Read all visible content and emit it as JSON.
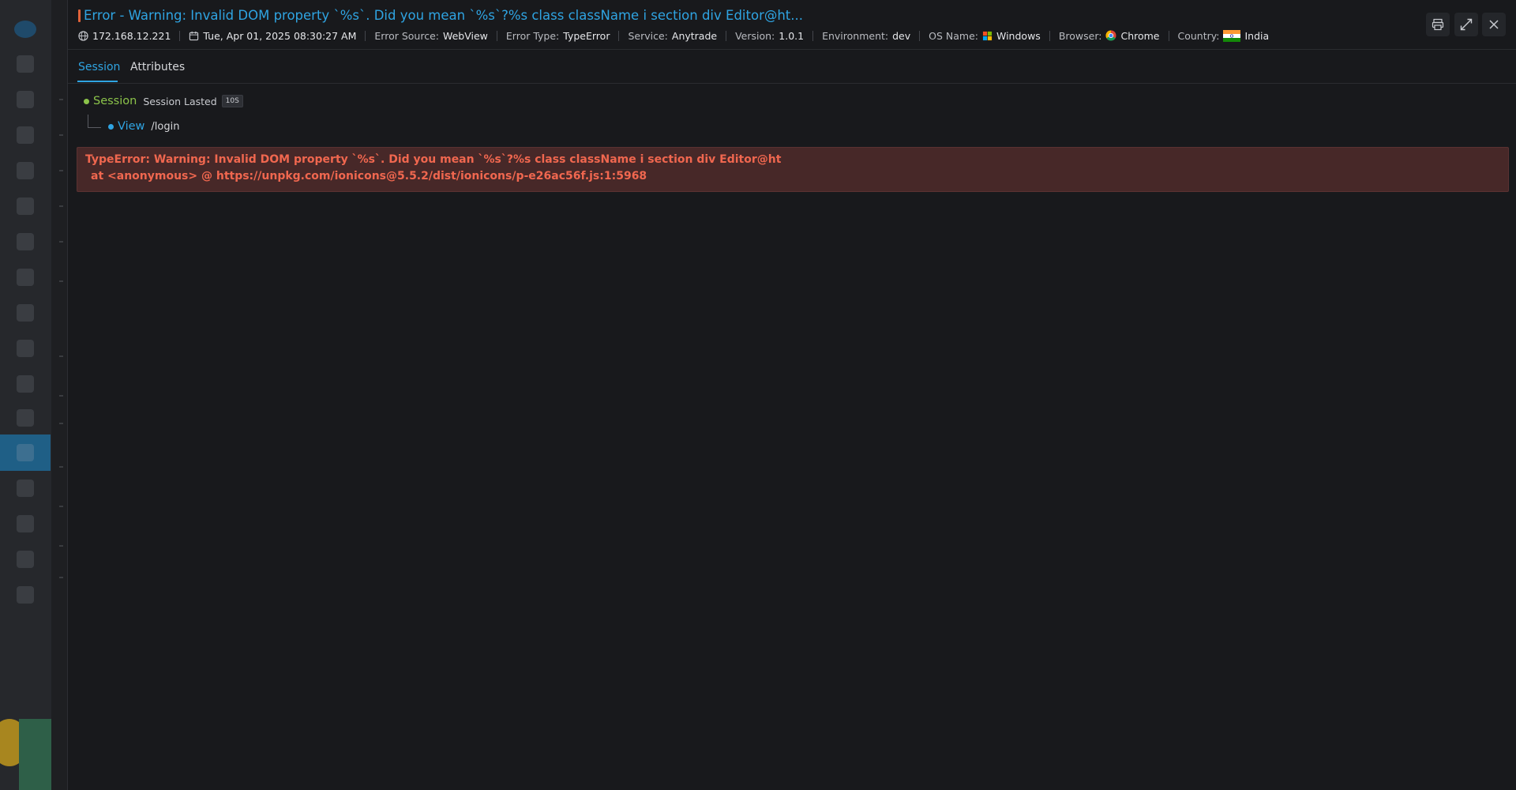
{
  "header": {
    "title": "Error - Warning: Invalid DOM property `%s`. Did you mean `%s`?%s class className i section div Editor@ht...",
    "ip": "172.168.12.221",
    "datetime": "Tue, Apr 01, 2025 08:30:27 AM",
    "meta": [
      {
        "label": "Error Source:",
        "value": "WebView"
      },
      {
        "label": "Error Type:",
        "value": "TypeError"
      },
      {
        "label": "Service:",
        "value": "Anytrade"
      },
      {
        "label": "Version:",
        "value": "1.0.1"
      },
      {
        "label": "Environment:",
        "value": "dev"
      },
      {
        "label": "OS Name:",
        "value": "Windows"
      },
      {
        "label": "Browser:",
        "value": "Chrome"
      },
      {
        "label": "Country:",
        "value": "India"
      }
    ],
    "icons": {
      "ip": "globe-icon",
      "date": "calendar-icon",
      "os": "windows-icon",
      "browser": "chrome-icon",
      "country": "india-flag-icon"
    },
    "buttons": {
      "report": "report-icon",
      "expand": "expand-icon",
      "close": "close-icon"
    }
  },
  "tabs": [
    {
      "label": "Session",
      "active": true
    },
    {
      "label": "Attributes",
      "active": false
    }
  ],
  "tree": {
    "session": {
      "name": "Session",
      "lasted_label": "Session Lasted",
      "duration": "10S"
    },
    "view": {
      "name": "View",
      "path": "/login"
    }
  },
  "error": {
    "line1": "TypeError: Warning: Invalid DOM property `%s`. Did you mean `%s`?%s class className i section div Editor@ht",
    "line2": "at <anonymous> @ https://unpkg.com/ionicons@5.5.2/dist/ionicons/p-e26ac56f.js:1:5968"
  },
  "colors": {
    "accent": "#2fa4e2",
    "session": "#8bc34a",
    "error_text": "#f0674f",
    "error_bg": "#472828"
  }
}
